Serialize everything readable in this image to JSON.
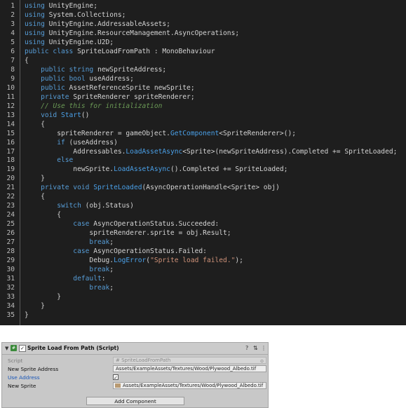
{
  "editor": {
    "lines": [
      [
        [
          "kw",
          "using"
        ],
        [
          "tx",
          " UnityEngine;"
        ]
      ],
      [
        [
          "kw",
          "using"
        ],
        [
          "tx",
          " System.Collections;"
        ]
      ],
      [
        [
          "kw",
          "using"
        ],
        [
          "tx",
          " UnityEngine.AddressableAssets;"
        ]
      ],
      [
        [
          "kw",
          "using"
        ],
        [
          "tx",
          " UnityEngine.ResourceManagement.AsyncOperations;"
        ]
      ],
      [
        [
          "kw",
          "using"
        ],
        [
          "tx",
          " UnityEngine.U2D;"
        ]
      ],
      [
        [
          "kw",
          "public class"
        ],
        [
          "tx",
          " SpriteLoadFromPath : MonoBehaviour"
        ]
      ],
      [
        [
          "tx",
          "{"
        ]
      ],
      [
        [
          "kw",
          "    public string"
        ],
        [
          "tx",
          " newSpriteAddress;"
        ]
      ],
      [
        [
          "kw",
          "    public bool"
        ],
        [
          "tx",
          " useAddress;"
        ]
      ],
      [
        [
          "kw",
          "    public"
        ],
        [
          "tx",
          " AssetReferenceSprite newSprite;"
        ]
      ],
      [
        [
          "kw",
          "    private"
        ],
        [
          "tx",
          " SpriteRenderer spriteRenderer;"
        ]
      ],
      [
        [
          "cm",
          "    // Use this for initialization"
        ]
      ],
      [
        [
          "kw",
          "    void"
        ],
        [
          "tx",
          " "
        ],
        [
          "fn",
          "Start"
        ],
        [
          "tx",
          "()"
        ]
      ],
      [
        [
          "tx",
          "    {"
        ]
      ],
      [
        [
          "tx",
          "        spriteRenderer = gameObject."
        ],
        [
          "fn",
          "GetComponent"
        ],
        [
          "tx",
          "<SpriteRenderer>();"
        ]
      ],
      [
        [
          "kw",
          "        if"
        ],
        [
          "tx",
          " (useAddress)"
        ]
      ],
      [
        [
          "tx",
          "            Addressables."
        ],
        [
          "fn",
          "LoadAssetAsync"
        ],
        [
          "tx",
          "<Sprite>(newSpriteAddress).Completed += SpriteLoaded;"
        ]
      ],
      [
        [
          "kw",
          "        else"
        ]
      ],
      [
        [
          "tx",
          "            newSprite."
        ],
        [
          "fn",
          "LoadAssetAsync"
        ],
        [
          "tx",
          "().Completed += SpriteLoaded;"
        ]
      ],
      [
        [
          "tx",
          "    }"
        ]
      ],
      [
        [
          "kw",
          "    private void"
        ],
        [
          "tx",
          " "
        ],
        [
          "fn",
          "SpriteLoaded"
        ],
        [
          "tx",
          "(AsyncOperationHandle<Sprite> obj)"
        ]
      ],
      [
        [
          "tx",
          "    {"
        ]
      ],
      [
        [
          "kw",
          "        switch"
        ],
        [
          "tx",
          " (obj.Status)"
        ]
      ],
      [
        [
          "tx",
          "        {"
        ]
      ],
      [
        [
          "kw",
          "            case"
        ],
        [
          "tx",
          " AsyncOperationStatus.Succeeded:"
        ]
      ],
      [
        [
          "tx",
          "                spriteRenderer.sprite = obj.Result;"
        ]
      ],
      [
        [
          "kw",
          "                break"
        ],
        [
          "tx",
          ";"
        ]
      ],
      [
        [
          "kw",
          "            case"
        ],
        [
          "tx",
          " AsyncOperationStatus.Failed:"
        ]
      ],
      [
        [
          "tx",
          "                Debug."
        ],
        [
          "fn",
          "LogError"
        ],
        [
          "tx",
          "("
        ],
        [
          "st",
          "\"Sprite load failed.\""
        ],
        [
          "tx",
          ");"
        ]
      ],
      [
        [
          "kw",
          "                break"
        ],
        [
          "tx",
          ";"
        ]
      ],
      [
        [
          "kw",
          "            default"
        ],
        [
          "tx",
          ":"
        ]
      ],
      [
        [
          "kw",
          "                break"
        ],
        [
          "tx",
          ";"
        ]
      ],
      [
        [
          "tx",
          "        }"
        ]
      ],
      [
        [
          "tx",
          "    }"
        ]
      ],
      [
        [
          "tx",
          "}"
        ]
      ]
    ]
  },
  "inspector": {
    "title": "Sprite Load From Path (Script)",
    "component_enabled": "✓",
    "header_icons": [
      "question-icon",
      "settings-icon",
      "more-icon"
    ],
    "rows": {
      "script": {
        "label": "Script",
        "value": "SpriteLoadFromPath"
      },
      "new_sprite_address": {
        "label": "New Sprite Address",
        "value": "Assets/ExampleAssets/Textures/Wood/Plywood_Albedo.tif"
      },
      "use_address": {
        "label": "Use Address",
        "value": "✓"
      },
      "new_sprite": {
        "label": "New Sprite",
        "value": "Assets/ExampleAssets/Textures/Wood/Plywood_Albedo.tif"
      }
    },
    "add_component_label": "Add Component"
  },
  "colors": {
    "editor_bg": "#1e1e1e",
    "keyword": "#569cd6",
    "method": "#4aa0e8",
    "string": "#ce9178",
    "comment": "#6a9955",
    "inspector_bg": "#c8c8c8",
    "link_blue": "#1a57b8"
  }
}
